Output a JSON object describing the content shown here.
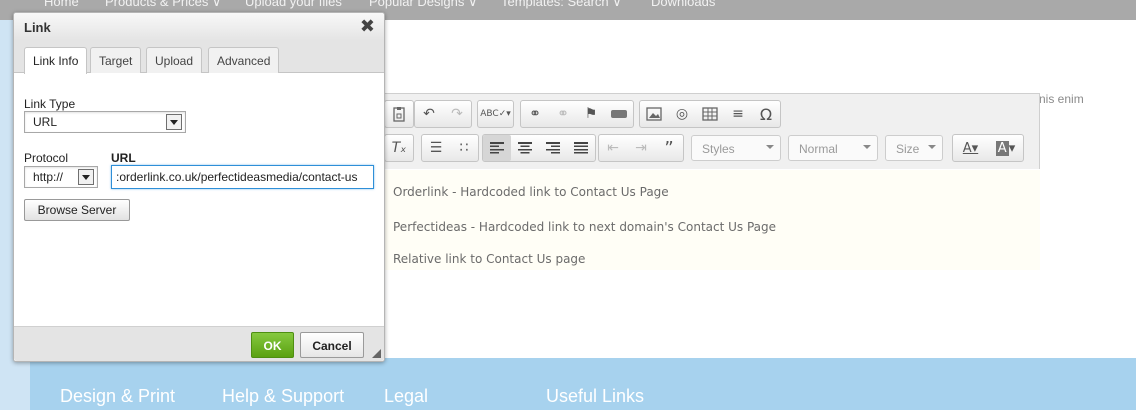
{
  "top_nav": {
    "items": [
      "Home",
      "Products & Prices ∨",
      "Upload your files",
      "Popular Designs ∨",
      "Templates: Search ∨",
      "Downloads"
    ]
  },
  "background": {
    "partial_text": "nis enim"
  },
  "toolbar": {
    "styles_label": "Styles",
    "format_label": "Normal",
    "size_label": "Size"
  },
  "editor_content": {
    "lines": [
      "Orderlink - Hardcoded link to Contact Us Page",
      "Perfectideas - Hardcoded link to next domain's Contact Us Page",
      "Relative link to Contact Us page"
    ]
  },
  "dialog": {
    "title": "Link",
    "close_glyph": "✖",
    "tabs": [
      "Link Info",
      "Target",
      "Upload",
      "Advanced"
    ],
    "active_tab": "Link Info",
    "link_type_label": "Link Type",
    "link_type_value": "URL",
    "protocol_label": "Protocol",
    "protocol_value": "http://",
    "url_label": "URL",
    "url_value": ":orderlink.co.uk/perfectideasmedia/contact-us",
    "browse_button": "Browse Server",
    "ok_button": "OK",
    "cancel_button": "Cancel"
  },
  "footer": {
    "items": [
      "Design & Print",
      "Help & Support",
      "Legal",
      "Useful Links"
    ]
  },
  "colors": {
    "accent_blue": "#2e8fd8",
    "ok_green": "#5aa111",
    "footer_blue": "#a7d2ee"
  }
}
